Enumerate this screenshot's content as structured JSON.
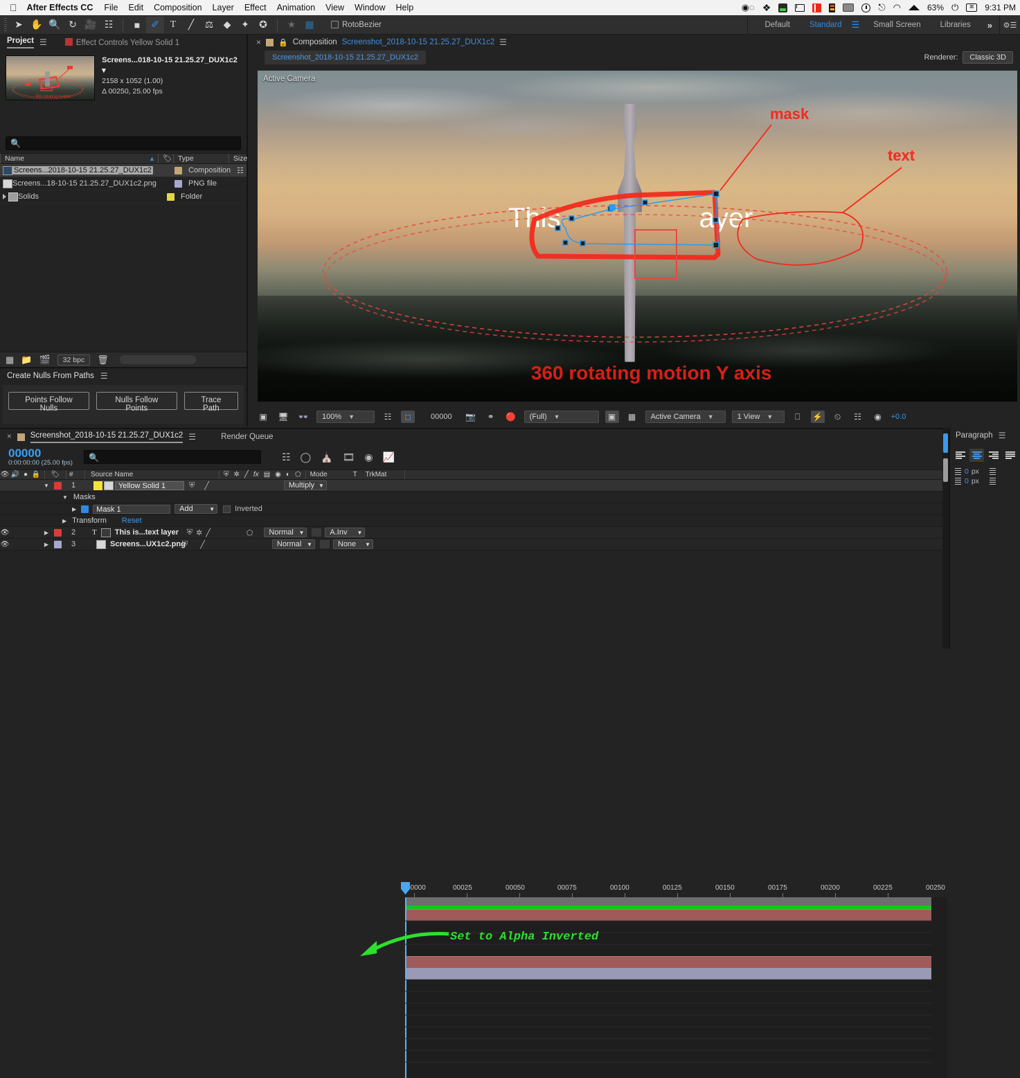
{
  "macbar": {
    "app_name": "After Effects CC",
    "menus": [
      "File",
      "Edit",
      "Composition",
      "Layer",
      "Effect",
      "Animation",
      "View",
      "Window",
      "Help"
    ],
    "status_icons": [
      "creative-cloud-icon",
      "dropbox-icon",
      "drive-icon",
      "waveform-icon",
      "red-app-icon",
      "color-strip-icon",
      "display-icon",
      "time-machine-icon",
      "bluetooth-icon",
      "wifi-icon",
      "airplay-icon"
    ],
    "battery": "63%",
    "clock": "9:31 PM"
  },
  "toolbar": {
    "tools": [
      "selection-tool",
      "hand-tool",
      "zoom-tool",
      "rotation-tool",
      "camera-tool",
      "pan-behind-tool",
      "shape-tool",
      "pen-tool",
      "type-tool",
      "brush-tool",
      "clone-stamp-tool",
      "eraser-tool",
      "roto-brush-tool",
      "puppet-tool"
    ],
    "active_tool": "pen-tool",
    "rotobezier_label": "RotoBezier",
    "rotobezier_checked": false,
    "workspaces": [
      "Default",
      "Standard",
      "Small Screen",
      "Libraries"
    ],
    "workspace_selected": "Standard",
    "overflow_label": "»"
  },
  "project": {
    "tab_label": "Project",
    "effect_controls_label": "Effect Controls Yellow Solid 1",
    "selected_item": {
      "name": "Screens...018-10-15 21.25.27_DUX1c2",
      "dimensions": "2158 x 1052 (1.00)",
      "duration": "Δ 00250, 25.00 fps"
    },
    "search_placeholder": "",
    "columns": [
      "Name",
      "Type",
      "Size"
    ],
    "items": [
      {
        "name": "Screens...2018-10-15 21.25.27_DUX1c2",
        "type": "Composition",
        "swatch": "#c2a678",
        "icon": "composition-icon",
        "selected": true
      },
      {
        "name": "Screens...18-10-15 21.25.27_DUX1c2.png",
        "type": "PNG file",
        "swatch": "#a7a7cf",
        "icon": "png-file-icon",
        "selected": false
      },
      {
        "name": "Solids",
        "type": "Folder",
        "swatch": "#e2d743",
        "icon": "folder-icon",
        "selected": false
      }
    ],
    "footer": {
      "bit_depth": "32 bpc"
    }
  },
  "create_nulls": {
    "title": "Create Nulls From Paths",
    "buttons": [
      "Points Follow Nulls",
      "Nulls Follow Points",
      "Trace Path"
    ]
  },
  "composition": {
    "panel_prefix": "Composition",
    "comp_name": "Screenshot_2018-10-15 21.25.27_DUX1c2",
    "tab_label": "Screenshot_2018-10-15 21.25.27_DUX1c2",
    "renderer_label": "Renderer:",
    "renderer_value": "Classic 3D",
    "view_label": "Active Camera",
    "canvas_text": "This is my text layer",
    "canvas_text_visible_left": "This",
    "canvas_text_visible_right": "ayer",
    "annotation_mask": "mask",
    "annotation_text": "text",
    "annotation_bottom": "360 rotating motion Y axis",
    "toolbar": {
      "zoom": "100%",
      "timecode": "00000",
      "resolution": "(Full)",
      "view_layout": "1 View",
      "camera": "Active Camera",
      "exposure": "+0.0"
    }
  },
  "timeline": {
    "tab_name": "Screenshot_2018-10-15 21.25.27_DUX1c2",
    "render_queue_label": "Render Queue",
    "timecode": "00000",
    "timecode_sub": "0:00:00:00 (25.00 fps)",
    "search_placeholder": "",
    "columns": [
      "#",
      "Source Name",
      "Mode",
      "T",
      "TrkMat"
    ],
    "ruler_labels": [
      "00000",
      "00025",
      "00050",
      "00075",
      "00100",
      "00125",
      "00150",
      "00175",
      "00200",
      "00225",
      "00250"
    ],
    "layers": [
      {
        "index": "1",
        "name": "Yellow Solid 1",
        "swatch": "#d93b3b",
        "color_chip": "#f2e33b",
        "mode": "Multiply",
        "trkmat": "",
        "selected": true,
        "expanded": true,
        "eye": false
      },
      {
        "index": "2",
        "name": "This is...text layer",
        "swatch": "#d93b3b",
        "color_chip": "",
        "mode": "Normal",
        "trkmat": "A.Inv",
        "selected": false,
        "expanded": false,
        "eye": true
      },
      {
        "index": "3",
        "name": "Screens...UX1c2.png",
        "swatch": "#a7a7cf",
        "color_chip": "",
        "mode": "Normal",
        "trkmat": "None",
        "selected": false,
        "expanded": false,
        "eye": true
      }
    ],
    "mask_group": {
      "masks_label": "Masks",
      "mask_name": "Mask 1",
      "mask_swatch": "#2e8ae5",
      "mask_mode": "Add",
      "inverted_label": "Inverted",
      "inverted_checked": false,
      "transform_label": "Transform",
      "reset_label": "Reset"
    },
    "annotation": "Set to Alpha Inverted",
    "annotation_color": "#2ee02e"
  },
  "paragraph": {
    "title": "Paragraph",
    "align_options": [
      "align-left",
      "align-center",
      "align-right",
      "align-justify-last-left"
    ],
    "align_selected": "align-center",
    "indent_left": "0",
    "indent_right": "0",
    "unit": "px"
  }
}
